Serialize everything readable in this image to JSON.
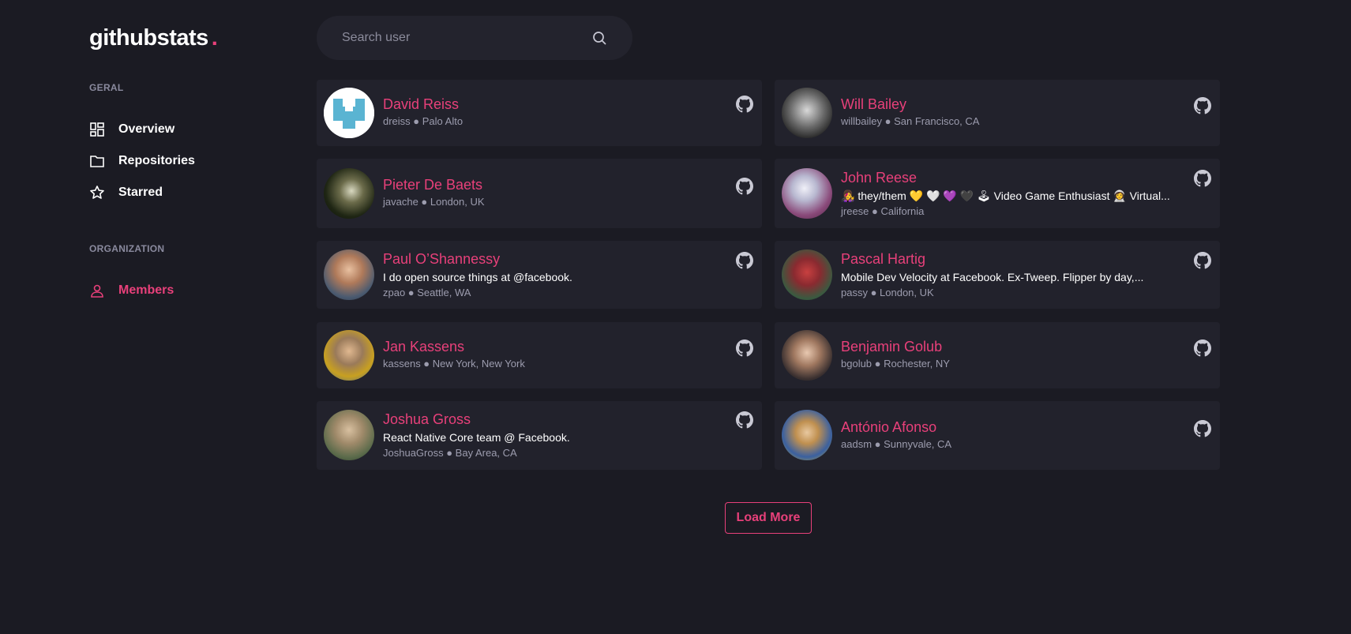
{
  "brand": {
    "name": "githubstats",
    "dot": ".",
    "accent": "#e8407a"
  },
  "sidebar": {
    "section_general": "GERAL",
    "section_org": "ORGANIZATION",
    "items": [
      {
        "label": "Overview",
        "icon": "dashboard-icon",
        "active": false
      },
      {
        "label": "Repositories",
        "icon": "folder-icon",
        "active": false
      },
      {
        "label": "Starred",
        "icon": "star-icon",
        "active": false
      },
      {
        "label": "Members",
        "icon": "user-icon",
        "active": true
      }
    ]
  },
  "search": {
    "placeholder": "Search user",
    "value": ""
  },
  "members": [
    {
      "name": "David Reiss",
      "bio": "",
      "login": "dreiss",
      "location": "Palo Alto",
      "meta": "dreiss ● Palo Alto"
    },
    {
      "name": "Will Bailey",
      "bio": "",
      "login": "willbailey",
      "location": "San Francisco, CA",
      "meta": "willbailey ● San Francisco, CA"
    },
    {
      "name": "Pieter De Baets",
      "bio": "",
      "login": "javache",
      "location": "London, UK",
      "meta": "javache ● London, UK"
    },
    {
      "name": "John Reese",
      "bio": "👩‍🎤 they/them 💛 🤍 💜 🖤 🕹 Video Game Enthusiast 👩‍🚀 Virtual...",
      "login": "jreese",
      "location": "California",
      "meta": "jreese ● California"
    },
    {
      "name": "Paul O’Shannessy",
      "bio": "I do open source things at @facebook.",
      "login": "zpao",
      "location": "Seattle, WA",
      "meta": "zpao ● Seattle, WA"
    },
    {
      "name": "Pascal Hartig",
      "bio": "Mobile Dev Velocity at Facebook. Ex-Tweep. Flipper by day,...",
      "login": "passy",
      "location": "London, UK",
      "meta": "passy ● London, UK"
    },
    {
      "name": "Jan Kassens",
      "bio": "",
      "login": "kassens",
      "location": "New York, New York",
      "meta": "kassens ● New York, New York"
    },
    {
      "name": "Benjamin Golub",
      "bio": "",
      "login": "bgolub",
      "location": "Rochester, NY",
      "meta": "bgolub ● Rochester, NY"
    },
    {
      "name": "Joshua Gross",
      "bio": "React Native Core team @ Facebook.",
      "login": "JoshuaGross",
      "location": "Bay Area, CA",
      "meta": "JoshuaGross ● Bay Area, CA"
    },
    {
      "name": "António Afonso",
      "bio": "",
      "login": "aadsm",
      "location": "Sunnyvale, CA",
      "meta": "aadsm ● Sunnyvale, CA"
    }
  ],
  "load_more_label": "Load More"
}
